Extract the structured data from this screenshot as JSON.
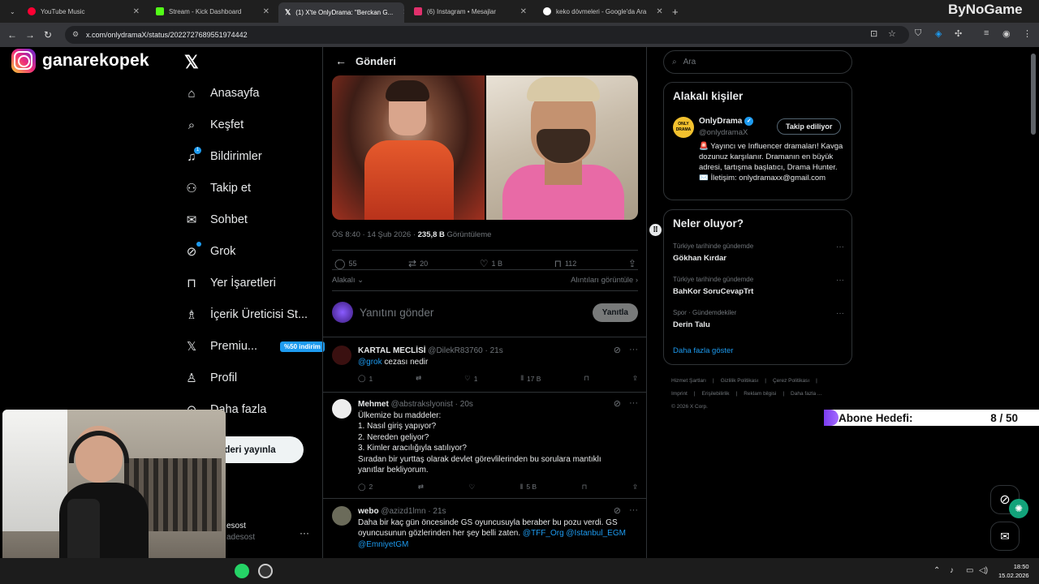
{
  "browser": {
    "tabs": [
      {
        "label": "YouTube Music",
        "color": "#ff0033"
      },
      {
        "label": "Stream - Kick Dashboard",
        "color": "#53fc18"
      },
      {
        "label": "(1) X'te OnlyDrama: \"Berckan G...",
        "color": "#ffffff"
      },
      {
        "label": "(6) Instagram • Mesajlar",
        "color": "#e1306c"
      },
      {
        "label": "keko dövmeleri - Google'da Ara",
        "color": "#4285f4"
      }
    ],
    "url": "x.com/onlydramaX/status/2022727689551974442",
    "watermark": "ByNoGame"
  },
  "brand": {
    "name": "ganarekopek"
  },
  "nav": {
    "items": [
      {
        "label": "Anasayfa",
        "icon": "home-icon"
      },
      {
        "label": "Keşfet",
        "icon": "search-icon"
      },
      {
        "label": "Bildirimler",
        "icon": "bell-icon"
      },
      {
        "label": "Takip et",
        "icon": "person-add-icon"
      },
      {
        "label": "Sohbet",
        "icon": "mail-icon"
      },
      {
        "label": "Grok",
        "icon": "grok-icon"
      },
      {
        "label": "Yer İşaretleri",
        "icon": "bookmark-icon"
      },
      {
        "label": "İçerik Üreticisi St...",
        "icon": "creator-icon"
      },
      {
        "label": "Premiu...",
        "icon": "x-premium-icon"
      },
      {
        "label": "Profil",
        "icon": "person-icon"
      },
      {
        "label": "Daha fazla",
        "icon": "more-icon"
      }
    ],
    "notif_count": "1",
    "promo": "%50 indirim",
    "post_button": "Gönderi yayınla",
    "account_name": "esost",
    "account_handle": "adesost"
  },
  "post": {
    "header": "Gönderi",
    "time": "ÖS 8:40 · 14 Şub 2026 · ",
    "views": "235,8 B",
    "views_label": " Görüntüleme",
    "replies": "55",
    "reposts": "20",
    "likes": "1 B",
    "bookmarks": "112",
    "relevant": "Alakalı",
    "quotes": "Alıntıları görüntüle",
    "reply_placeholder": "Yanıtını gönder",
    "reply_button": "Yanıtla"
  },
  "replies": [
    {
      "name": "KARTAL MECLİSİ",
      "handle": "@DilekR83760 · 21s",
      "text_link": "@grok",
      "text": " cezası nedir",
      "c": "1",
      "r": "",
      "l": "1",
      "v": "17 B"
    },
    {
      "name": "Mehmet",
      "handle": "@abstrakslyonist · 20s",
      "lines": [
        "Ülkemize bu maddeler:",
        "1. Nasıl giriş yapıyor?",
        "2. Nereden geliyor?",
        "3. Kimler aracılığıyla satılıyor?",
        "Sıradan bir yurttaş olarak devlet görevlilerinden bu sorulara mantıklı",
        "yanıtlar bekliyorum."
      ],
      "c": "2",
      "r": "",
      "l": "",
      "v": "5 B"
    },
    {
      "name": "webo",
      "handle": "@azizd1lmn · 21s",
      "lines": [
        "Daha bir kaç gün öncesinde GS oyuncusuyla beraber bu pozu verdi. GS",
        "oyuncusunun gözlerinden her şey belli zaten. "
      ],
      "links": "@TFF_Org @Istanbul_EGM",
      "links2": "@EmniyetGM"
    }
  ],
  "right": {
    "search_placeholder": "Ara",
    "related_title": "Alakalı kişiler",
    "od_name": "OnlyDrama",
    "od_handle": "@onlydramaX",
    "od_follow": "Takip ediliyor",
    "od_bio": "🚨 Yayıncı ve Influencer dramaları! Kavga dozunuz karşılanır. Dramanın en büyük adresi, tartışma başlatıcı, Drama Hunter. ✉️ İletişim: onlydramaxx@gmail.com",
    "trends_title": "Neler oluyor?",
    "trends": [
      {
        "cat": "Türkiye tarihinde gündemde",
        "name": "Gökhan Kırdar"
      },
      {
        "cat": "Türkiye tarihinde gündemde",
        "name": "BahKor SoruCevapTrt"
      },
      {
        "cat": "Spor · Gündemdekiler",
        "name": "Derin Talu"
      }
    ],
    "show_more": "Daha fazla göster",
    "footer": [
      "Hizmet Şartları",
      "|",
      "Gizlilik Politikası",
      "|",
      "Çerez Politikası",
      "|",
      "Imprint",
      "|",
      "Erişilebilirlik",
      "|",
      "Reklam bilgisi",
      "|",
      "Daha fazla ...",
      "© 2026 X Corp."
    ]
  },
  "overlay": {
    "goal_label": "Abone Hedefi:",
    "goal_value": "8 / 50",
    "goal_fraction": 0.16
  },
  "taskbar": {
    "time": "18:50",
    "date": "15.02.2026"
  }
}
